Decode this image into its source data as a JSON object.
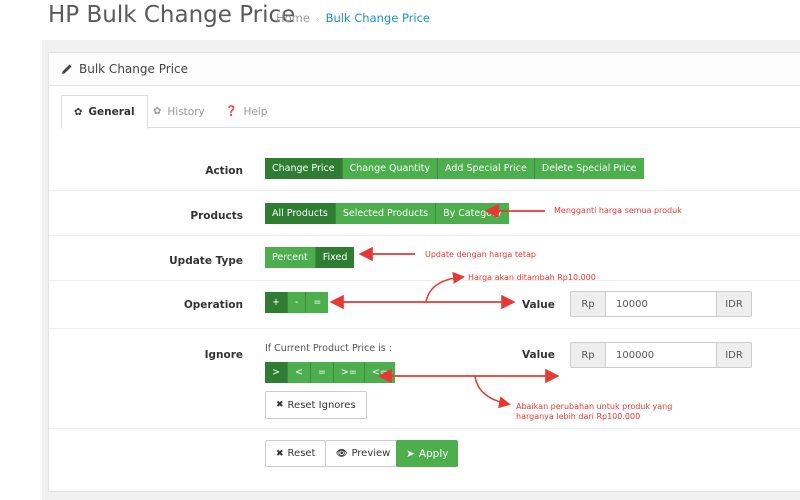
{
  "header": {
    "title": "HP Bulk Change Price",
    "breadcrumb": [
      {
        "label": "Home"
      },
      {
        "label": "Bulk Change Price"
      }
    ]
  },
  "panel": {
    "title": "Bulk Change Price",
    "tabs": [
      {
        "label": "General",
        "icon": "gear-icon",
        "active": true
      },
      {
        "label": "History",
        "icon": "gear-icon",
        "active": false
      },
      {
        "label": "Help",
        "icon": "question-circle-icon",
        "active": false
      }
    ]
  },
  "form": {
    "action": {
      "label": "Action",
      "options": [
        "Change Price",
        "Change Quantity",
        "Add Special Price",
        "Delete Special Price"
      ],
      "selected": "Change Price"
    },
    "products": {
      "label": "Products",
      "options": [
        "All Products",
        "Selected Products",
        "By Category"
      ],
      "selected": "All Products"
    },
    "update_type": {
      "label": "Update Type",
      "options": [
        "Percent",
        "Fixed"
      ],
      "selected": "Fixed"
    },
    "operation": {
      "label": "Operation",
      "options": [
        "+",
        "-",
        "="
      ],
      "selected": "+",
      "value_label": "Value",
      "prefix": "Rp",
      "value": "10000",
      "suffix": "IDR"
    },
    "ignore": {
      "label": "Ignore",
      "condition_text": "If Current Product Price is :",
      "options": [
        ">",
        "<",
        "=",
        ">=",
        "<="
      ],
      "selected": ">",
      "value_label": "Value",
      "prefix": "Rp",
      "value": "100000",
      "suffix": "IDR",
      "reset_label": "Reset Ignores"
    }
  },
  "actions": {
    "reset_label": "Reset",
    "preview_label": "Preview",
    "apply_label": "Apply"
  },
  "annotations": {
    "products_note": "Mengganti harga semua produk",
    "update_type_note": "Update dengan harga tetap",
    "operation_note": "Harga akan ditambah Rp10.000",
    "ignore_note_1": "Abaikan perubahan untuk produk yang",
    "ignore_note_2": "harganya lebih dari Rp100.000"
  },
  "colors": {
    "accent_green": "#4cae4c",
    "active_green": "#2f7d32",
    "link_blue": "#1e91cf",
    "annotation_red": "#e53935"
  }
}
